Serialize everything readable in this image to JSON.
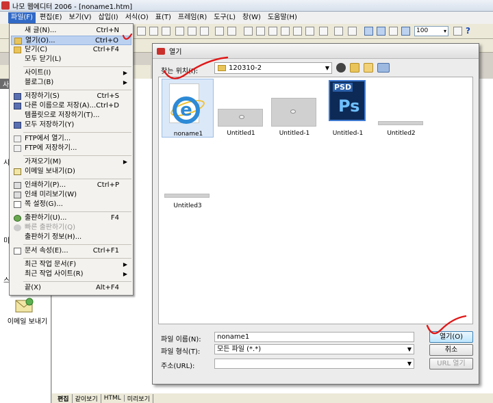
{
  "window": {
    "title": "나모 웹에디터 2006 - [noname1.htm]"
  },
  "menubar": {
    "items": [
      "파일(F)",
      "편집(E)",
      "보기(V)",
      "삽입(I)",
      "서식(O)",
      "표(T)",
      "프레임(R)",
      "도구(L)",
      "창(W)",
      "도움말(H)"
    ]
  },
  "toolbar": {
    "zoom": "100",
    "help": "?"
  },
  "file_menu": {
    "items": [
      {
        "label": "새 글(N)...",
        "shortcut": "Ctrl+N"
      },
      {
        "label": "열기(O)...",
        "shortcut": "Ctrl+O"
      },
      {
        "label": "닫기(C)",
        "shortcut": "Ctrl+F4"
      },
      {
        "label": "모두 닫기(L)",
        "shortcut": ""
      },
      {
        "label": "사이트(I)",
        "shortcut": ""
      },
      {
        "label": "블로그(B)",
        "shortcut": ""
      },
      {
        "label": "저장하기(S)",
        "shortcut": "Ctrl+S"
      },
      {
        "label": "다른 이름으로 저장(A)...",
        "shortcut": "Ctrl+D"
      },
      {
        "label": "템플릿으로 저장하기(T)...",
        "shortcut": ""
      },
      {
        "label": "모두 저장하기(Y)",
        "shortcut": ""
      },
      {
        "label": "FTP에서 열기...",
        "shortcut": ""
      },
      {
        "label": "FTP에 저장하기...",
        "shortcut": ""
      },
      {
        "label": "가져오기(M)",
        "shortcut": ""
      },
      {
        "label": "이메일 보내기(D)",
        "shortcut": ""
      },
      {
        "label": "인쇄하기(P)...",
        "shortcut": "Ctrl+P"
      },
      {
        "label": "인쇄 미리보기(W)",
        "shortcut": ""
      },
      {
        "label": "쪽 설정(G)...",
        "shortcut": ""
      },
      {
        "label": "출판하기(U)...",
        "shortcut": "F4"
      },
      {
        "label": "빠른 출판하기(Q)",
        "shortcut": ""
      },
      {
        "label": "출판하기 정보(H)...",
        "shortcut": ""
      },
      {
        "label": "문서 속성(E)...",
        "shortcut": "Ctrl+F1"
      },
      {
        "label": "최근 작업 문서(F)",
        "shortcut": ""
      },
      {
        "label": "최근 작업 사이트(R)",
        "shortcut": ""
      },
      {
        "label": "끝(X)",
        "shortcut": "Alt+F4"
      }
    ]
  },
  "sidebar": {
    "tab": "사",
    "letters": [
      "시",
      "미",
      "스"
    ],
    "email_label": "이메일 보내기"
  },
  "bottom_tabs": [
    "편집",
    "같이보기",
    "HTML",
    "미리보기"
  ],
  "open_dialog": {
    "title": "열기",
    "look_in_label": "찾는 위치(I):",
    "look_in_value": "120310-2",
    "files": [
      {
        "name": "noname1",
        "kind": "html"
      },
      {
        "name": "Untitled1",
        "kind": "thumb"
      },
      {
        "name": "Untitled-1",
        "kind": "thumb"
      },
      {
        "name": "Untitled-1",
        "kind": "psd"
      },
      {
        "name": "Untitled2",
        "kind": "bar"
      },
      {
        "name": "Untitled3",
        "kind": "bar"
      }
    ],
    "psd_badge": "PSD",
    "psd_letters": "Ps",
    "filename_label": "파일 이름(N):",
    "filename_value": "noname1",
    "filetype_label": "파일 형식(T):",
    "filetype_value": "모든 파일 (*.*)",
    "url_label": "주소(URL):",
    "url_value": "",
    "open_button": "열기(O)",
    "cancel_button": "취소",
    "url_open_button": "URL 열기"
  },
  "colors": {
    "menu_highlight": "#bcd1f0",
    "annotation_red": "#e01818",
    "menubar_active": "#3169c6"
  }
}
